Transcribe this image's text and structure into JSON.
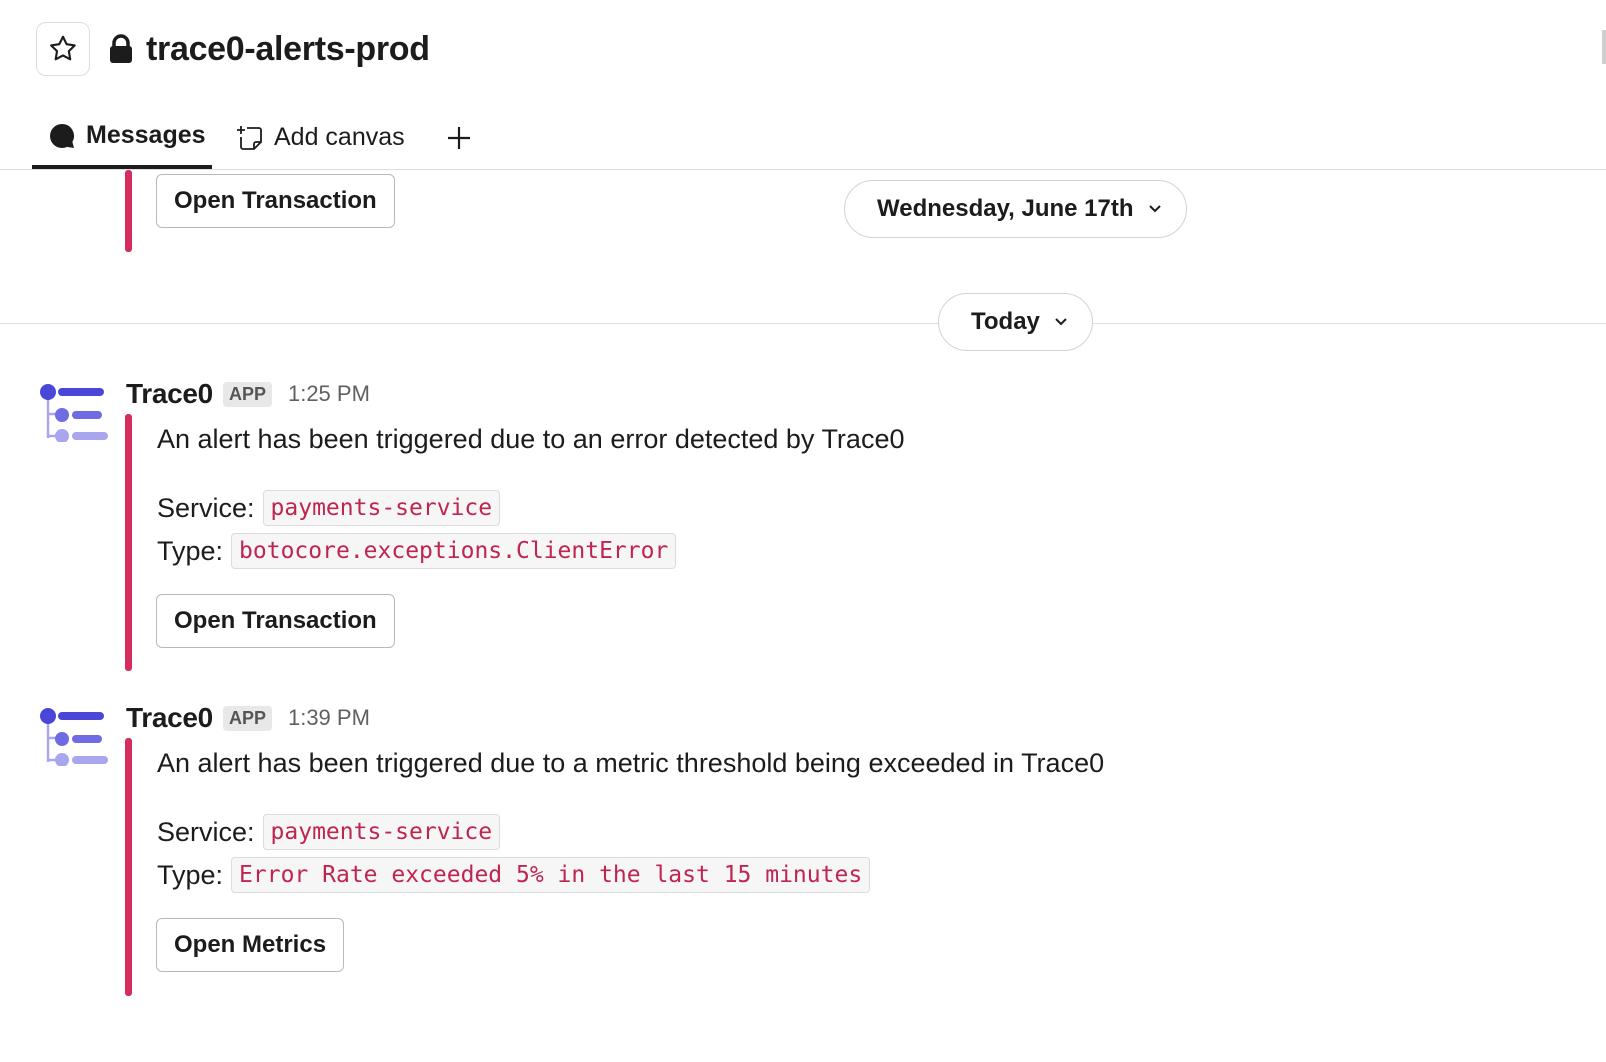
{
  "header": {
    "star_icon": "star-icon",
    "lock_icon": "lock-icon",
    "channel_name": "trace0-alerts-prod"
  },
  "tabs": [
    {
      "label": "Messages",
      "icon": "message-bubble-icon",
      "active": true
    },
    {
      "label": "Add canvas",
      "icon": "canvas-icon",
      "active": false
    },
    {
      "label": "+",
      "icon": "plus-icon",
      "active": false
    }
  ],
  "prev_message": {
    "button_label": "Open Transaction"
  },
  "date_dividers": [
    {
      "label": "Wednesday, June 17th"
    },
    {
      "label": "Today"
    }
  ],
  "messages": [
    {
      "sender": "Trace0",
      "badge": "APP",
      "time": "1:25 PM",
      "text": "An alert has been triggered due to an error detected by Trace0",
      "service_label": "Service:",
      "service_value": "payments-service",
      "type_label": "Type:",
      "type_value": "botocore.exceptions.ClientError",
      "button_label": "Open Transaction"
    },
    {
      "sender": "Trace0",
      "badge": "APP",
      "time": "1:39 PM",
      "text": "An alert has been triggered due to a metric threshold being exceeded in Trace0",
      "service_label": "Service:",
      "service_value": "payments-service",
      "type_label": "Type:",
      "type_value": "Error Rate exceeded 5% in the last 15 minutes",
      "button_label": "Open Metrics"
    }
  ],
  "colors": {
    "accent_bar": "#d52d5d",
    "code_text": "#c0254f",
    "avatar_dark": "#4a47d6",
    "avatar_mid": "#6f6be3",
    "avatar_light": "#a9a6ee"
  }
}
